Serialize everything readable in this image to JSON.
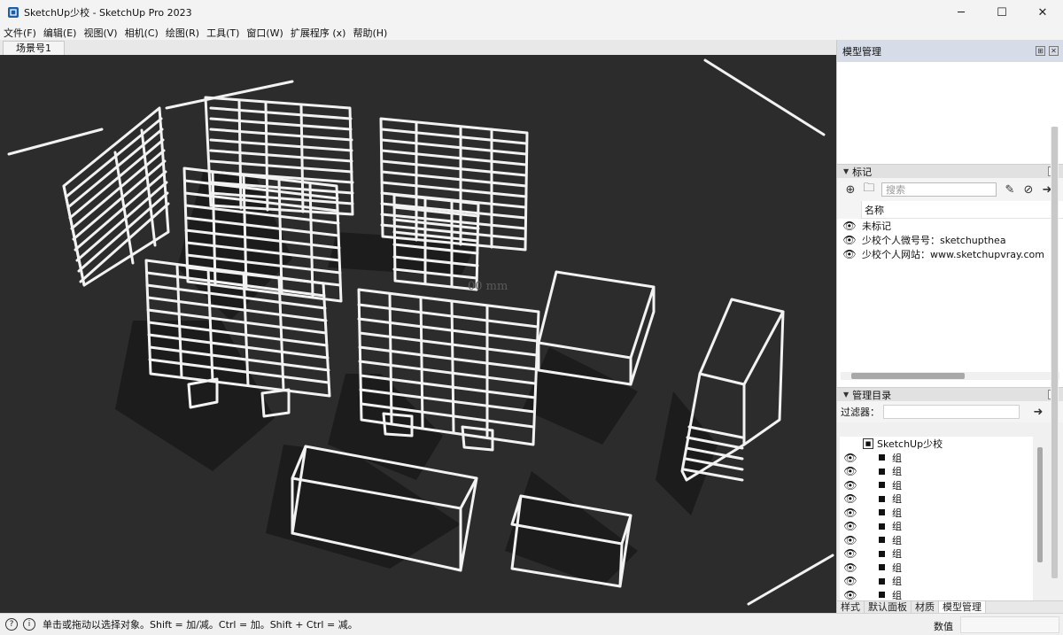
{
  "window": {
    "title": "SketchUp少校 - SketchUp Pro 2023",
    "controls": [
      "─",
      "☐",
      "✕"
    ]
  },
  "menu": [
    "文件(F)",
    "编辑(E)",
    "视图(V)",
    "相机(C)",
    "绘图(R)",
    "工具(T)",
    "窗口(W)",
    "扩展程序 (x)",
    "帮助(H)"
  ],
  "scene_tab": "场景号1",
  "viewport": {
    "dimension_text": "00 mm",
    "background": "#2c2c2c",
    "edge_color": "#f2f2f2"
  },
  "tray": {
    "title": "模型管理",
    "tags": {
      "title": "标记",
      "search_placeholder": "搜索",
      "column_name": "名称",
      "rows": [
        "未标记",
        "少校个人微号号：sketchupthea",
        "少校个人网站：www.sketchupvray.com"
      ]
    },
    "outliner": {
      "title": "管理目录",
      "filter_label": "过滤器：",
      "root": "SketchUp少校",
      "items": [
        "组",
        "组",
        "组",
        "组",
        "组",
        "组",
        "组",
        "组",
        "组",
        "组",
        "组"
      ]
    },
    "tabs": [
      "样式",
      "默认面板",
      "材质",
      "模型管理"
    ]
  },
  "status": {
    "message": "单击或拖动以选择对象。Shift = 加/减。Ctrl = 加。Shift + Ctrl = 减。",
    "value_label": "数值"
  }
}
